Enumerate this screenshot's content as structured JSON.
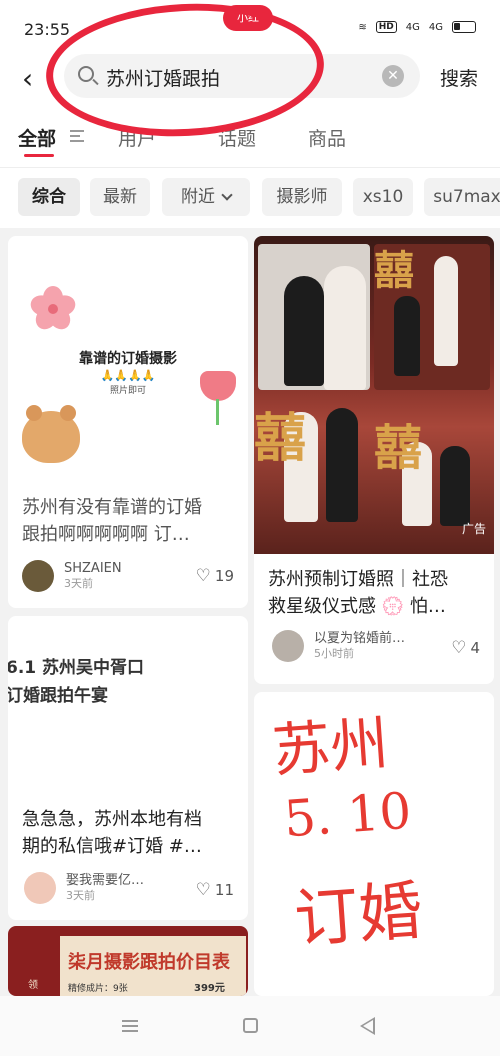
{
  "status_bar": {
    "time": "23:55",
    "pill": "小红",
    "hd": "HD",
    "net1": "4G",
    "net2": "4G"
  },
  "search": {
    "query": "苏州订婚跟拍",
    "button": "搜索"
  },
  "tabs": [
    {
      "label": "全部"
    },
    {
      "label": "用户"
    },
    {
      "label": "话题"
    },
    {
      "label": "商品"
    }
  ],
  "chips": [
    {
      "label": "综合"
    },
    {
      "label": "最新"
    },
    {
      "label": "附近"
    },
    {
      "label": "摄影师"
    },
    {
      "label": "xs10"
    },
    {
      "label": "su7max"
    }
  ],
  "cards": [
    {
      "graphic_heading": "靠谱的订婚摄影",
      "graphic_hands": "🙏🙏🙏🙏",
      "graphic_sub": "照片即可",
      "title_line1": "苏州有没有靠谱的订婚",
      "title_line2": "跟拍啊啊啊啊啊 订…",
      "author": "SHZAIEN",
      "time": "3天前",
      "likes": "19"
    },
    {
      "photo_char": "囍",
      "ad": "广告",
      "title_line1": "苏州预制订婚照｜社恐",
      "title_line2": "救星级仪式感 💮 怕…",
      "author": "以夏为铭婚前…",
      "time": "5小时前",
      "likes": "4"
    },
    {
      "text_line1": "6.1 苏州吴中胥口",
      "text_line2": "订婚跟拍午宴",
      "title_line1": "急急急，苏州本地有档",
      "title_line2": "期的私信哦#订婚 #…",
      "author": "娶我需要亿…",
      "time": "3天前",
      "likes": "11"
    },
    {
      "hand_line1": "苏州",
      "hand_line2": "5. 10",
      "hand_line3": "订婚"
    },
    {
      "price_title": "柒月摄影跟拍价目表",
      "price_line": "精修成片：9张",
      "price_value": "399元",
      "side": "领"
    }
  ],
  "colors": {
    "accent": "#e8263d",
    "handwriting": "#e63a32"
  }
}
